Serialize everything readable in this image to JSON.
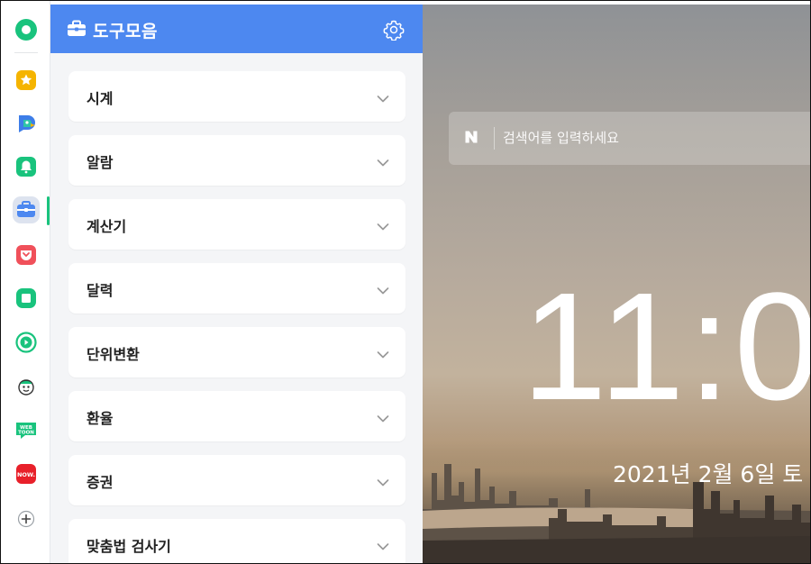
{
  "panel": {
    "title": "도구모음",
    "title_icon": "toolbox-icon",
    "settings_icon": "gear-icon",
    "header_color": "#4d88f0"
  },
  "tools": [
    {
      "label": "시계"
    },
    {
      "label": "알람"
    },
    {
      "label": "계산기"
    },
    {
      "label": "달력"
    },
    {
      "label": "단위변환"
    },
    {
      "label": "환율"
    },
    {
      "label": "증권"
    },
    {
      "label": "맞춤법 검사기"
    }
  ],
  "rail": {
    "items": [
      {
        "name": "whale-home-icon",
        "color": "#19c37d"
      },
      {
        "name": "favorites-star-icon",
        "color": "#f5b400"
      },
      {
        "name": "papago-icon",
        "color": "#2ec4a6"
      },
      {
        "name": "alarm-bell-icon",
        "color": "#19c37d"
      },
      {
        "name": "toolbox-icon",
        "color": "#4d88f0",
        "active": true
      },
      {
        "name": "pocket-icon",
        "color": "#f0505a"
      },
      {
        "name": "memo-icon",
        "color": "#19c37d"
      },
      {
        "name": "play-icon",
        "color": "#19c37d"
      },
      {
        "name": "character-icon",
        "color": "#333333"
      },
      {
        "name": "webtoon-icon",
        "color": "#19c37d",
        "text": "WEB TOON"
      },
      {
        "name": "now-icon",
        "color": "#e8202a",
        "text": "NOW."
      },
      {
        "name": "add-icon",
        "color": "#555555"
      }
    ],
    "active_color": "#19c37d"
  },
  "search": {
    "logo": "N",
    "placeholder": "검색어를 입력하세요"
  },
  "clock": {
    "time": "11:0"
  },
  "date": {
    "text": "2021년 2월 6일 토"
  }
}
